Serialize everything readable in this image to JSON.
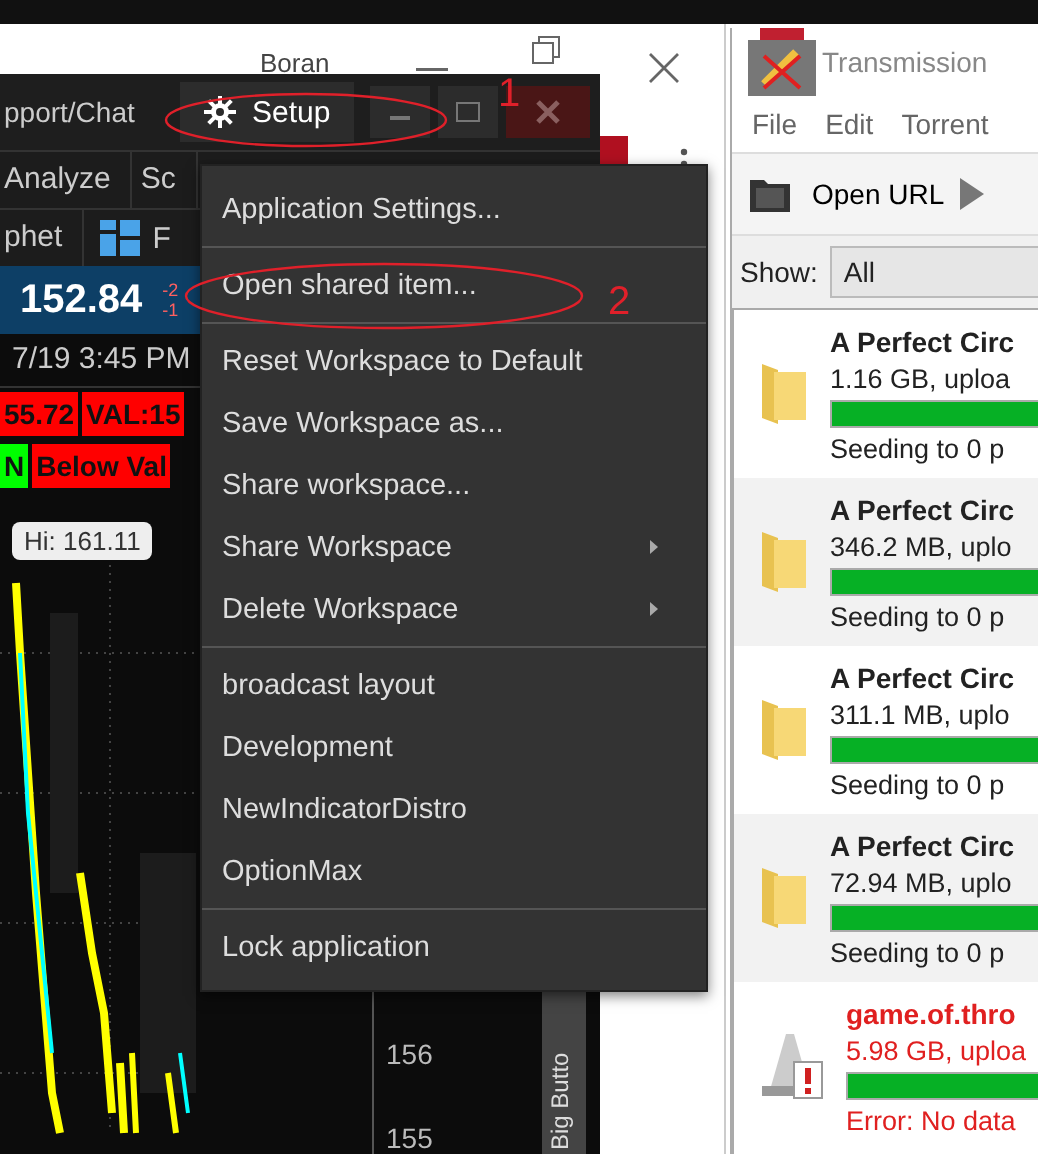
{
  "background_window": {
    "title": "Boran"
  },
  "trading_app": {
    "header_tab": "pport/Chat",
    "setup_button": "Setup",
    "nav": [
      "Analyze",
      "Sc"
    ],
    "nav2": [
      "phet",
      "F"
    ],
    "quote": {
      "price": "152.84",
      "change": [
        "-2",
        "-1"
      ]
    },
    "datetime": "7/19 3:45 PM",
    "badge_rows": [
      [
        {
          "text": "55.72",
          "color": "#ff0000"
        },
        {
          "text": "VAL:15",
          "color": "#ff0000"
        }
      ],
      [
        {
          "text": "N",
          "color": "#00ff00"
        },
        {
          "text": "Below Val",
          "color": "#ff0000"
        }
      ]
    ],
    "tooltip": "Hi: 161.11",
    "price_axis": [
      "156",
      "155"
    ],
    "side_tab": "Big Butto"
  },
  "setup_menu": {
    "groups": [
      [
        {
          "label": "Application Settings...",
          "submenu": false
        }
      ],
      [
        {
          "label": "Open shared item...",
          "submenu": false
        }
      ],
      [
        {
          "label": "Reset Workspace to Default",
          "submenu": false
        },
        {
          "label": "Save Workspace as...",
          "submenu": false
        },
        {
          "label": "Share workspace...",
          "submenu": false
        },
        {
          "label": "Share Workspace",
          "submenu": true
        },
        {
          "label": "Delete Workspace",
          "submenu": true
        }
      ],
      [
        {
          "label": "broadcast layout",
          "submenu": false
        },
        {
          "label": "Development",
          "submenu": false
        },
        {
          "label": "NewIndicatorDistro",
          "submenu": false
        },
        {
          "label": "OptionMax",
          "submenu": false
        }
      ],
      [
        {
          "label": "Lock application",
          "submenu": false
        }
      ]
    ]
  },
  "annotations": [
    "1",
    "2"
  ],
  "transmission": {
    "title": "Transmission",
    "menu": [
      "File",
      "Edit",
      "Torrent"
    ],
    "toolbar": "Open URL",
    "filter_label": "Show:",
    "filter_value": "All",
    "torrents": [
      {
        "name": "A Perfect Circ",
        "size": "1.16 GB, uploa",
        "level": 1,
        "status": "Seeding to 0 p",
        "error": false
      },
      {
        "name": "A Perfect Circ",
        "size": "346.2 MB, uplo",
        "level": 1,
        "status": "Seeding to 0 p",
        "error": false
      },
      {
        "name": "A Perfect Circ",
        "size": "311.1 MB, uplo",
        "level": 1,
        "status": "Seeding to 0 p",
        "error": false
      },
      {
        "name": "A Perfect Circ",
        "size": "72.94 MB, uplo",
        "level": 1,
        "status": "Seeding to 0 p",
        "error": false
      },
      {
        "name": "game.of.thro",
        "size": "5.98 GB, uploa",
        "level": 1,
        "status": "Error: No data",
        "error": true
      }
    ]
  }
}
